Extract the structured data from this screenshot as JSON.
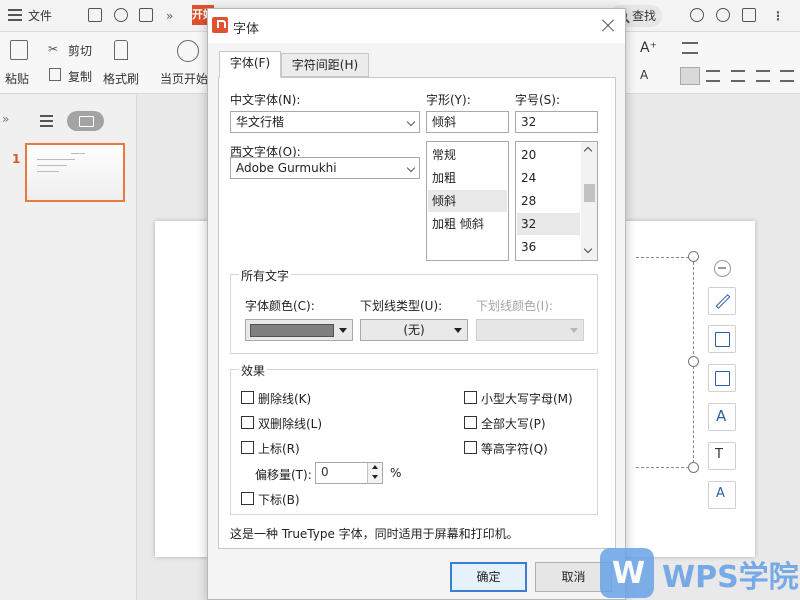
{
  "app": {
    "menu_label": "文件",
    "start_tab": "开始",
    "search_label": "查找",
    "ribbon": {
      "paste": "粘贴",
      "cut": "剪切",
      "copy": "复制",
      "format_painter": "格式刷",
      "from_current": "当页开始"
    },
    "slide_number": "1"
  },
  "dialog": {
    "title": "字体",
    "tabs": [
      {
        "label": "字体(F)",
        "active": true
      },
      {
        "label": "字符间距(H)",
        "active": false
      }
    ],
    "chinese_font": {
      "label": "中文字体(N):",
      "value": "华文行楷"
    },
    "western_font": {
      "label": "西文字体(O):",
      "value": "Adobe Gurmukhi"
    },
    "style": {
      "label": "字形(Y):",
      "value": "倾斜",
      "options": [
        "常规",
        "加粗",
        "倾斜",
        "加粗 倾斜"
      ],
      "selected_index": 2
    },
    "size": {
      "label": "字号(S):",
      "value": "32",
      "options": [
        "20",
        "24",
        "28",
        "32",
        "36"
      ],
      "selected_index": 3
    },
    "all_text": {
      "title": "所有文字",
      "font_color_label": "字体颜色(C):",
      "font_color": "#7f7f7f",
      "underline_type_label": "下划线类型(U):",
      "underline_type_value": "(无)",
      "underline_color_label": "下划线颜色(I):"
    },
    "effects": {
      "title": "效果",
      "strikethrough": "删除线(K)",
      "double_strikethrough": "双删除线(L)",
      "superscript": "上标(R)",
      "offset_label": "偏移量(T):",
      "offset_value": "0",
      "offset_unit": "%",
      "subscript": "下标(B)",
      "small_caps": "小型大写字母(M)",
      "all_caps": "全部大写(P)",
      "equal_height": "等高字符(Q)"
    },
    "description": "这是一种 TrueType 字体，同时适用于屏幕和打印机。",
    "ok_label": "确定",
    "cancel_label": "取消"
  },
  "watermark": {
    "text": "WPS学院"
  }
}
